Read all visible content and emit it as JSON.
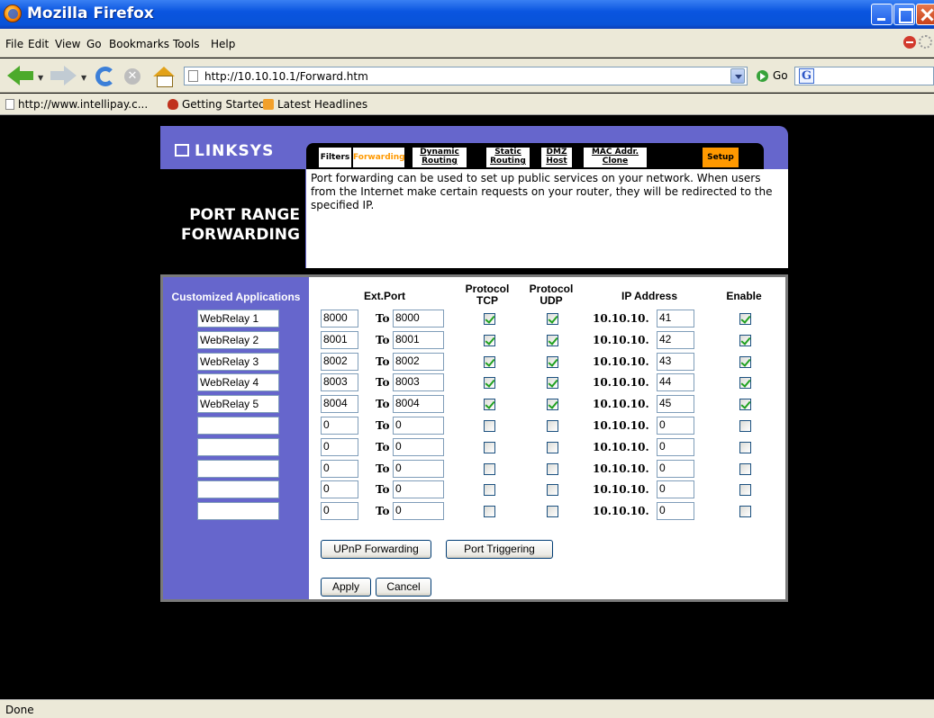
{
  "window": {
    "title": "Mozilla Firefox"
  },
  "menu": [
    "File",
    "Edit",
    "View",
    "Go",
    "Bookmarks",
    "Tools",
    "Help"
  ],
  "nav": {
    "url": "http://10.10.10.1/Forward.htm",
    "go_label": "Go"
  },
  "bookmarks": [
    "http://www.intellipay.c...",
    "Getting Started",
    "Latest Headlines"
  ],
  "brand": {
    "logo": "LINKSYS"
  },
  "tabs": [
    {
      "line1": "Filters",
      "line2": ""
    },
    {
      "line1": "Forwarding",
      "line2": ""
    },
    {
      "line1": "Dynamic",
      "line2": "Routing"
    },
    {
      "line1": "Static",
      "line2": "Routing"
    },
    {
      "line1": "DMZ",
      "line2": "Host"
    },
    {
      "line1": "MAC Addr.",
      "line2": "Clone"
    },
    {
      "line1": "Setup",
      "line2": ""
    }
  ],
  "page": {
    "title_line1": "PORT RANGE",
    "title_line2": "FORWARDING",
    "description": "Port forwarding can be used to set up public services on your network. When users from the Internet make certain requests on your router, they will be redirected to the specified IP."
  },
  "table": {
    "headers": {
      "apps": "Customized Applications",
      "ext_port": "Ext.Port",
      "tcp_1": "Protocol",
      "tcp_2": "TCP",
      "udp_1": "Protocol",
      "udp_2": "UDP",
      "ip": "IP Address",
      "enable": "Enable"
    },
    "to_label": "To",
    "ip_prefix": "10.10.10.",
    "rows": [
      {
        "app": "WebRelay 1",
        "start": "8000",
        "end": "8000",
        "tcp": true,
        "udp": true,
        "ip": "41",
        "enable": true
      },
      {
        "app": "WebRelay 2",
        "start": "8001",
        "end": "8001",
        "tcp": true,
        "udp": true,
        "ip": "42",
        "enable": true
      },
      {
        "app": "WebRelay 3",
        "start": "8002",
        "end": "8002",
        "tcp": true,
        "udp": true,
        "ip": "43",
        "enable": true
      },
      {
        "app": "WebRelay 4",
        "start": "8003",
        "end": "8003",
        "tcp": true,
        "udp": true,
        "ip": "44",
        "enable": true
      },
      {
        "app": "WebRelay 5",
        "start": "8004",
        "end": "8004",
        "tcp": true,
        "udp": true,
        "ip": "45",
        "enable": true
      },
      {
        "app": "",
        "start": "0",
        "end": "0",
        "tcp": false,
        "udp": false,
        "ip": "0",
        "enable": false
      },
      {
        "app": "",
        "start": "0",
        "end": "0",
        "tcp": false,
        "udp": false,
        "ip": "0",
        "enable": false
      },
      {
        "app": "",
        "start": "0",
        "end": "0",
        "tcp": false,
        "udp": false,
        "ip": "0",
        "enable": false
      },
      {
        "app": "",
        "start": "0",
        "end": "0",
        "tcp": false,
        "udp": false,
        "ip": "0",
        "enable": false
      },
      {
        "app": "",
        "start": "0",
        "end": "0",
        "tcp": false,
        "udp": false,
        "ip": "0",
        "enable": false
      }
    ]
  },
  "buttons": {
    "upnp": "UPnP Forwarding",
    "trigger": "Port Triggering",
    "apply": "Apply",
    "cancel": "Cancel"
  },
  "status": {
    "text": "Done"
  }
}
